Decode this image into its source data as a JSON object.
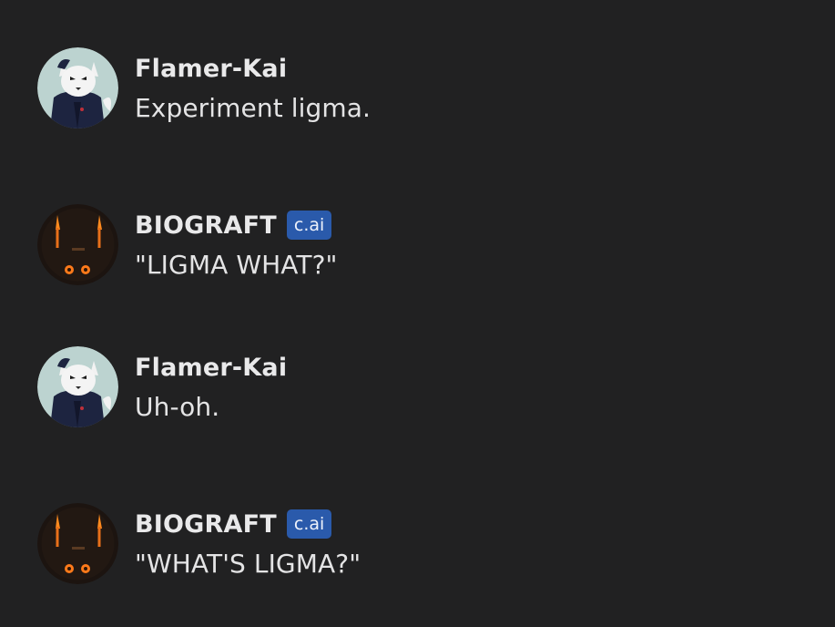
{
  "messages": [
    {
      "author": "Flamer-Kai",
      "avatar_icon": "white-wolf-avatar-icon",
      "badge": "",
      "text": "Experiment ligma."
    },
    {
      "author": "BIOGRAFT",
      "avatar_icon": "orange-eyed-robot-avatar-icon",
      "badge": "c.ai",
      "text": "\"LIGMA WHAT?\""
    },
    {
      "author": "Flamer-Kai",
      "avatar_icon": "white-wolf-avatar-icon",
      "badge": "",
      "text": "Uh-oh."
    },
    {
      "author": "BIOGRAFT",
      "avatar_icon": "orange-eyed-robot-avatar-icon",
      "badge": "c.ai",
      "text": "\"WHAT'S LIGMA?\""
    }
  ],
  "colors": {
    "background": "#212122",
    "badge_background": "#2a5aab",
    "name_text": "#e9e9ea",
    "message_text": "#e4e4e5"
  }
}
